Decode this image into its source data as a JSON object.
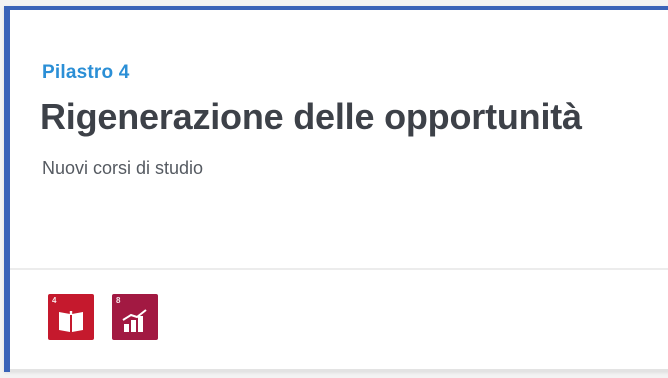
{
  "card": {
    "eyebrow": "Pilastro 4",
    "title": "Rigenerazione delle opportunità",
    "subtitle": "Nuovi corsi di studio"
  },
  "sdg_badges": [
    {
      "number": "4",
      "icon": "open-book-icon",
      "color": "#c5192d"
    },
    {
      "number": "8",
      "icon": "growth-chart-icon",
      "color": "#a21942"
    }
  ],
  "colors": {
    "accent_border": "#3a63b8",
    "eyebrow": "#2b8fd6",
    "title": "#3d4148"
  }
}
